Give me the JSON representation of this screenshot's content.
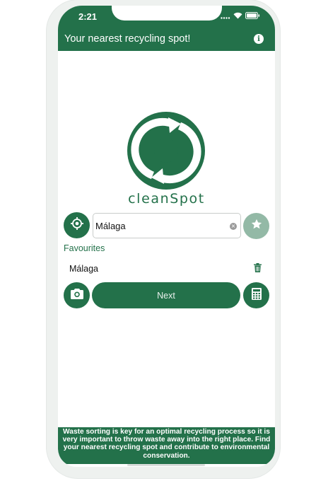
{
  "status_bar": {
    "time": "2:21"
  },
  "header": {
    "title": "Your nearest recycling spot!",
    "info_icon": "info-icon"
  },
  "logo": {
    "brand": "cleanSpot",
    "icon": "recycle-logo-icon"
  },
  "search": {
    "value": "Málaga",
    "locate_icon": "crosshair-icon",
    "favourite_icon": "star-icon"
  },
  "favourites": {
    "heading": "Favourites",
    "items": [
      {
        "label": "Málaga",
        "delete_icon": "trash-icon"
      }
    ]
  },
  "actions": {
    "next_label": "Next",
    "camera_icon": "camera-icon",
    "calculator_icon": "calculator-icon"
  },
  "footer": {
    "text": "Waste sorting is key for an optimal recycling process so it is very important to throw waste away into the right place. Find your nearest recycling spot and contribute to environmental conservation."
  },
  "colors": {
    "primary": "#23714a",
    "primary_faded": "#93b9a6",
    "background": "#ffffff"
  }
}
